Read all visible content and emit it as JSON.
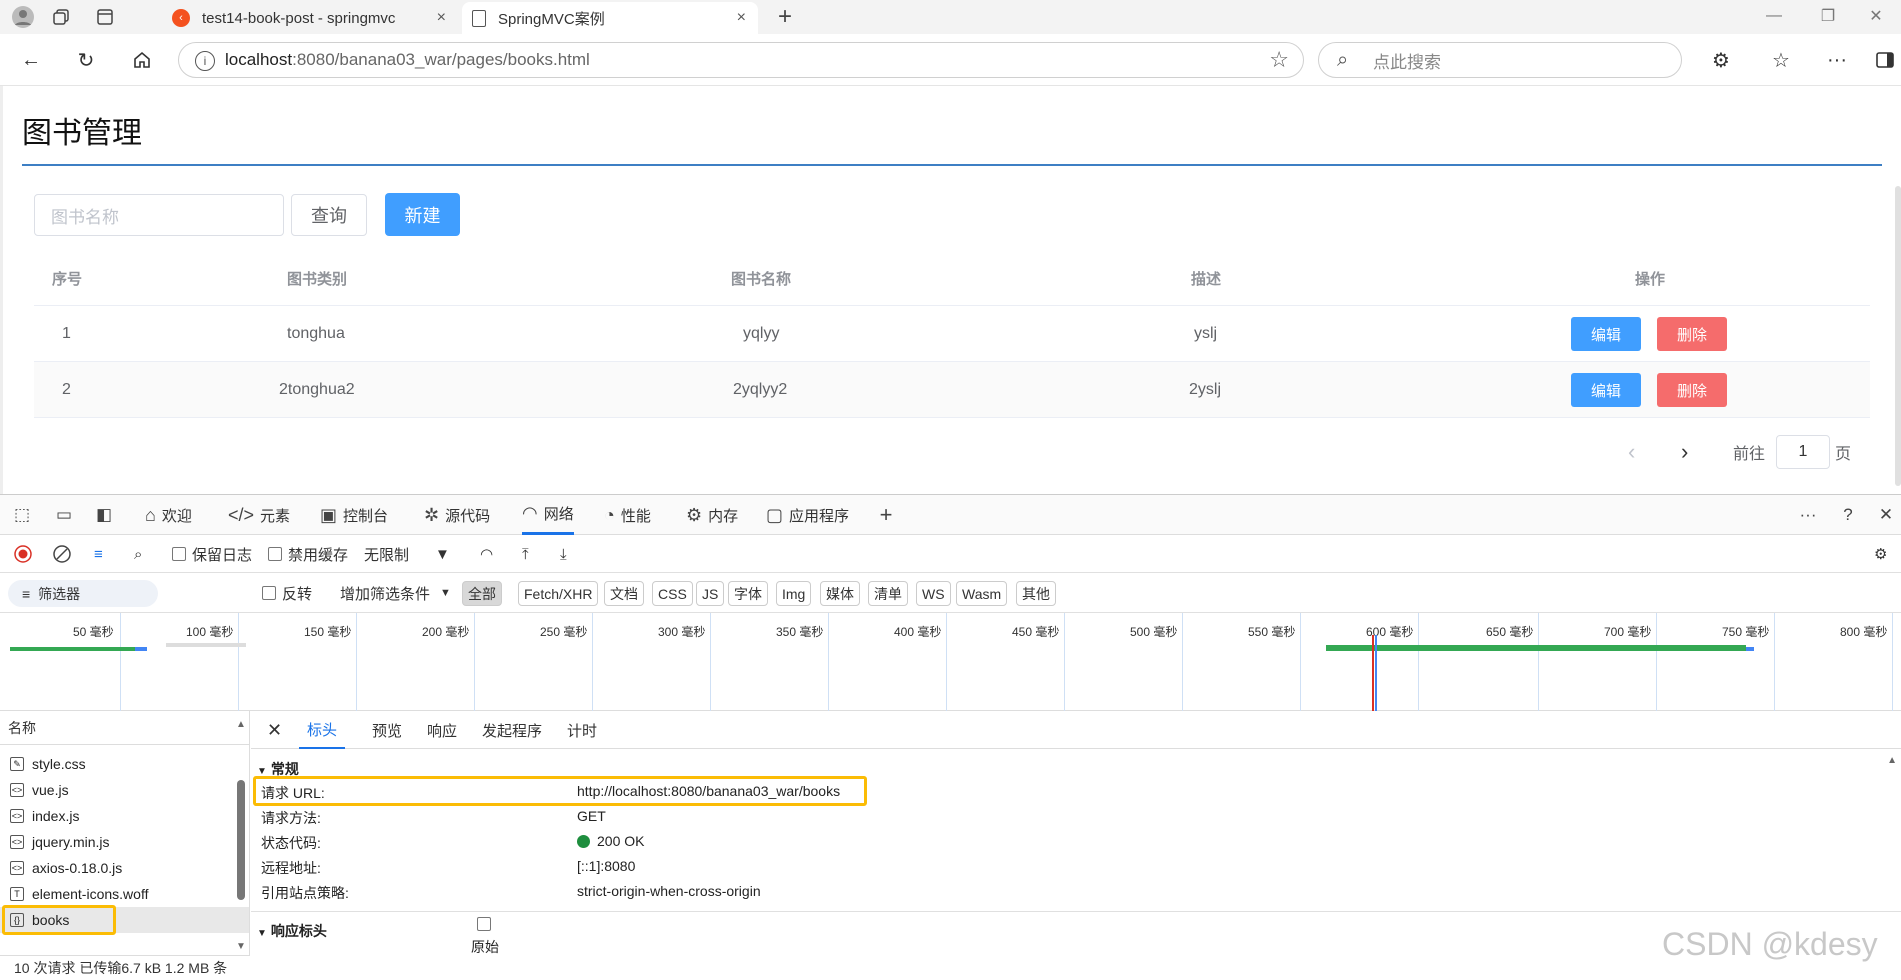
{
  "browser": {
    "tabs": [
      {
        "title": "test14-book-post - springmvc",
        "close": "×"
      },
      {
        "title": "SpringMVC案例",
        "close": "×"
      }
    ],
    "new_tab": "+",
    "url_host": "localhost",
    "url_rest": ":8080/banana03_war/pages/books.html",
    "search_placeholder": "点此搜索"
  },
  "page": {
    "title": "图书管理",
    "search_placeholder": "图书名称",
    "query_button": "查询",
    "new_button": "新建",
    "table": {
      "headers": [
        "序号",
        "图书类别",
        "图书名称",
        "描述",
        "操作"
      ],
      "rows": [
        {
          "no": "1",
          "type": "tonghua",
          "name": "yqlyy",
          "desc": "yslj"
        },
        {
          "no": "2",
          "type": "2tonghua2",
          "name": "2yqlyy2",
          "desc": "2yslj"
        }
      ],
      "edit_label": "编辑",
      "delete_label": "删除"
    },
    "pager": {
      "goto_label": "前往",
      "page_value": "1",
      "page_suffix": "页",
      "prev": "‹",
      "next": "›"
    }
  },
  "devtools": {
    "tabs": [
      {
        "label": "欢迎",
        "icon": "home-icon"
      },
      {
        "label": "元素",
        "icon": "code-icon"
      },
      {
        "label": "控制台",
        "icon": "console-icon"
      },
      {
        "label": "源代码",
        "icon": "bug-icon"
      },
      {
        "label": "网络",
        "icon": "wifi-icon"
      },
      {
        "label": "性能",
        "icon": "performance-icon"
      },
      {
        "label": "内存",
        "icon": "memory-icon"
      },
      {
        "label": "应用程序",
        "icon": "app-icon"
      }
    ],
    "toolbar": {
      "preserve_log": "保留日志",
      "disable_cache": "禁用缓存",
      "throttle": "无限制"
    },
    "filter": {
      "placeholder": "筛选器",
      "invert": "反转",
      "more_filters": "增加筛选条件",
      "types": [
        "全部",
        "Fetch/XHR",
        "文档",
        "CSS",
        "JS",
        "字体",
        "Img",
        "媒体",
        "清单",
        "WS",
        "Wasm",
        "其他"
      ]
    },
    "timeline_ticks": [
      "50 毫秒",
      "100 毫秒",
      "150 毫秒",
      "200 毫秒",
      "250 毫秒",
      "300 毫秒",
      "350 毫秒",
      "400 毫秒",
      "450 毫秒",
      "500 毫秒",
      "550 毫秒",
      "600 毫秒",
      "650 毫秒",
      "700 毫秒",
      "750 毫秒",
      "800 毫秒"
    ],
    "request_list": {
      "header": "名称",
      "items": [
        "style.css",
        "vue.js",
        "index.js",
        "jquery.min.js",
        "axios-0.18.0.js",
        "element-icons.woff",
        "books"
      ]
    },
    "detail": {
      "tabs": [
        "标头",
        "预览",
        "响应",
        "发起程序",
        "计时"
      ],
      "general_title": "常规",
      "fields": [
        {
          "key": "请求 URL:",
          "value": "http://localhost:8080/banana03_war/books"
        },
        {
          "key": "请求方法:",
          "value": "GET"
        },
        {
          "key": "状态代码:",
          "value": "200 OK"
        },
        {
          "key": "远程地址:",
          "value": "[::1]:8080"
        },
        {
          "key": "引用站点策略:",
          "value": "strict-origin-when-cross-origin"
        }
      ],
      "response_headers_title": "响应标头",
      "raw_label": "原始"
    },
    "status": "10 次请求   已传输6.7 kB   1.2 MB 条"
  },
  "watermark": "CSDN @kdesy",
  "colors": {
    "primary": "#409eff",
    "danger": "#f56c6c",
    "highlight": "#fbbc05",
    "rule": "#3d7fc4"
  }
}
